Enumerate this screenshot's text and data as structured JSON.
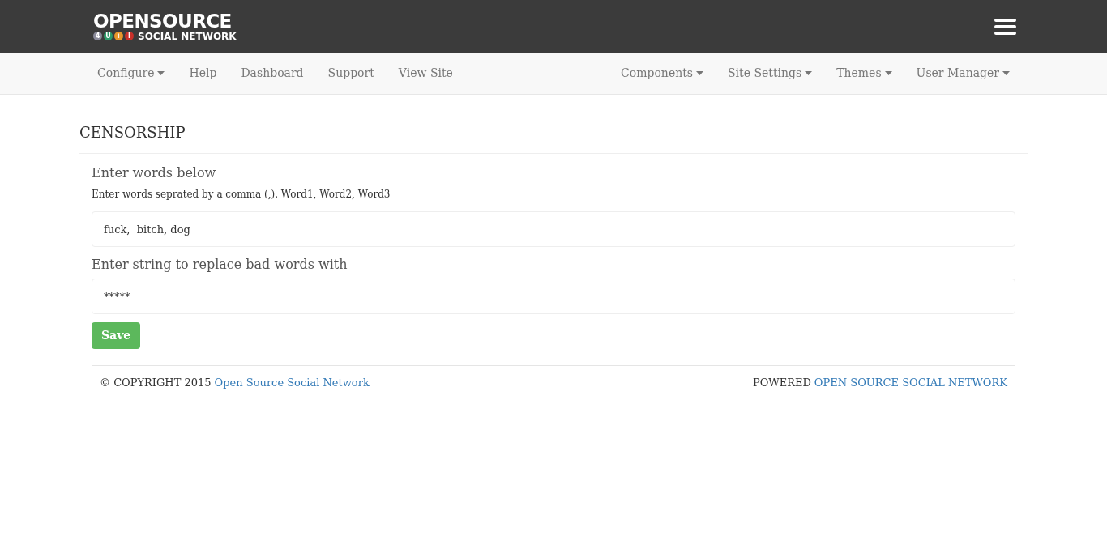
{
  "logo": {
    "title": "OPENSOURCE",
    "badges": [
      {
        "text": "4",
        "color": "#8a8a9a"
      },
      {
        "text": "U",
        "color": "#2e9a6a"
      },
      {
        "text": "+",
        "color": "#e8962a"
      },
      {
        "text": "I",
        "color": "#c8302a"
      }
    ],
    "subtitle": "SOCIAL NETWORK"
  },
  "nav_left": [
    {
      "label": "Configure",
      "dropdown": true
    },
    {
      "label": "Help",
      "dropdown": false
    },
    {
      "label": "Dashboard",
      "dropdown": false
    },
    {
      "label": "Support",
      "dropdown": false
    },
    {
      "label": "View Site",
      "dropdown": false
    }
  ],
  "nav_right": [
    {
      "label": "Components",
      "dropdown": true
    },
    {
      "label": "Site Settings",
      "dropdown": true
    },
    {
      "label": "Themes",
      "dropdown": true
    },
    {
      "label": "User Manager",
      "dropdown": true
    }
  ],
  "page_title": "CENSORSHIP",
  "form": {
    "words_label": "Enter words below",
    "words_hint": "Enter words seprated by a comma (,). Word1, Word2, Word3",
    "words_value": "fuck,  bitch, dog",
    "replace_label": "Enter string to replace bad words with",
    "replace_value": "*****",
    "save": "Save"
  },
  "footer": {
    "copyright": "© COPYRIGHT 2015",
    "copyright_link": "Open Source Social Network",
    "powered": "POWERED",
    "powered_link": "OPEN SOURCE SOCIAL NETWORK"
  }
}
